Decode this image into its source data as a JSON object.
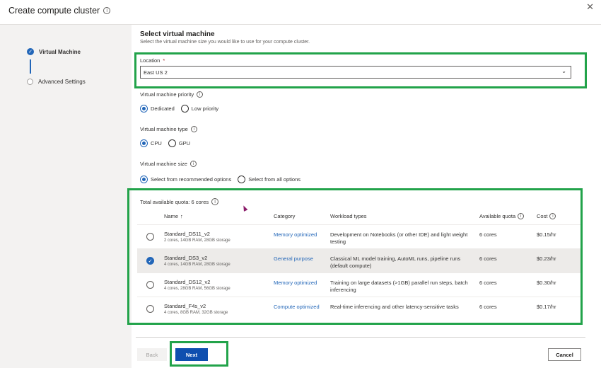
{
  "dialog": {
    "title": "Create compute cluster"
  },
  "steps": [
    {
      "label": "Virtual Machine",
      "state": "active"
    },
    {
      "label": "Advanced Settings",
      "state": "pending"
    }
  ],
  "main": {
    "heading": "Select virtual machine",
    "subheading": "Select the virtual machine size you would like to use for your compute cluster.",
    "location": {
      "label": "Location",
      "required_mark": "*",
      "value": "East US 2"
    },
    "priority": {
      "label": "Virtual machine priority",
      "options": [
        "Dedicated",
        "Low priority"
      ],
      "selected": "Dedicated"
    },
    "vm_type": {
      "label": "Virtual machine type",
      "options": [
        "CPU",
        "GPU"
      ],
      "selected": "CPU"
    },
    "vm_size": {
      "label": "Virtual machine size",
      "options": [
        "Select from recommended options",
        "Select from all options"
      ],
      "selected": "Select from recommended options"
    },
    "quota": {
      "label": "Total available quota: 6 cores"
    },
    "table": {
      "headers": {
        "name": "Name",
        "sort_icon": "↑",
        "category": "Category",
        "workload": "Workload types",
        "available": "Available quota",
        "cost": "Cost"
      },
      "rows": [
        {
          "name": "Standard_DS11_v2",
          "specs": "2 cores, 14GB RAM, 28GB storage",
          "category": "Memory optimized",
          "workload": "Development on Notebooks (or other IDE) and light weight testing",
          "available": "6 cores",
          "cost": "$0.15/hr",
          "selected": false
        },
        {
          "name": "Standard_DS3_v2",
          "specs": "4 cores, 14GB RAM, 28GB storage",
          "category": "General purpose",
          "workload": "Classical ML model training, AutoML runs, pipeline runs (default compute)",
          "available": "6 cores",
          "cost": "$0.23/hr",
          "selected": true
        },
        {
          "name": "Standard_DS12_v2",
          "specs": "4 cores, 28GB RAM, 56GB storage",
          "category": "Memory optimized",
          "workload": "Training on large datasets (>1GB) parallel run steps, batch inferencing",
          "available": "6 cores",
          "cost": "$0.30/hr",
          "selected": false
        },
        {
          "name": "Standard_F4s_v2",
          "specs": "4 cores, 8GB RAM, 32GB storage",
          "category": "Compute optimized",
          "workload": "Real-time inferencing and other latency-sensitive tasks",
          "available": "6 cores",
          "cost": "$0.17/hr",
          "selected": false
        }
      ]
    }
  },
  "footer": {
    "back": "Back",
    "next": "Next",
    "cancel": "Cancel"
  },
  "colors": {
    "accent": "#2266b8",
    "primary_button": "#0f4faf",
    "highlight": "#22a34a"
  },
  "icons": {
    "info": "info-icon",
    "close": "close-icon",
    "chevron": "chevron-down-icon",
    "check": "checkmark-icon"
  }
}
